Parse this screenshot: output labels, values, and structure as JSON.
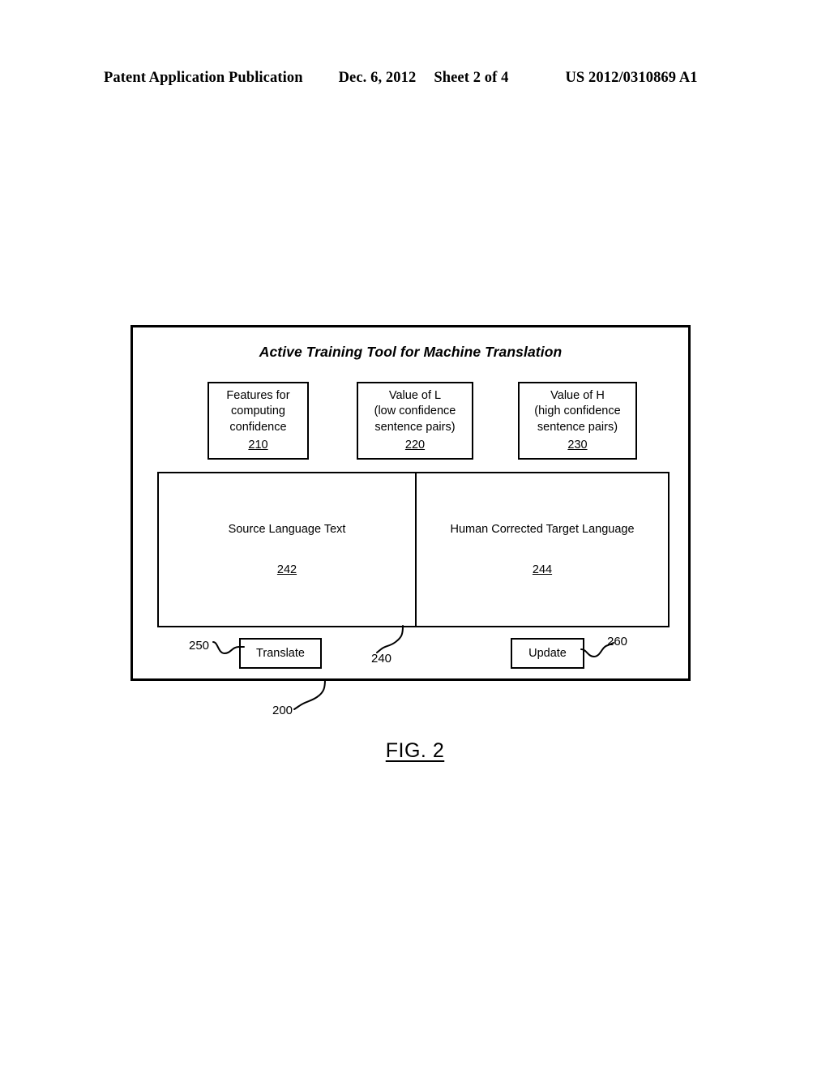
{
  "header": {
    "publication": "Patent Application Publication",
    "date": "Dec. 6, 2012",
    "sheet": "Sheet 2 of 4",
    "patent_number": "US 2012/0310869 A1"
  },
  "figure": {
    "caption": "FIG. 2",
    "system_ref": "200",
    "title": "Active Training Tool for Machine Translation",
    "param_boxes": [
      {
        "line1": "Features for",
        "line2": "computing",
        "line3": "confidence",
        "ref": "210"
      },
      {
        "line1": "Value of L",
        "line2": "(low confidence",
        "line3": "sentence pairs)",
        "ref": "220"
      },
      {
        "line1": "Value of H",
        "line2": "(high confidence",
        "line3": "sentence pairs)",
        "ref": "230"
      }
    ],
    "panels_ref": "240",
    "panels": [
      {
        "label": "Source Language Text",
        "ref": "242"
      },
      {
        "label": "Human Corrected Target Language",
        "ref": "244"
      }
    ],
    "buttons": [
      {
        "label": "Translate",
        "ref": "250"
      },
      {
        "label": "Update",
        "ref": "260"
      }
    ]
  }
}
